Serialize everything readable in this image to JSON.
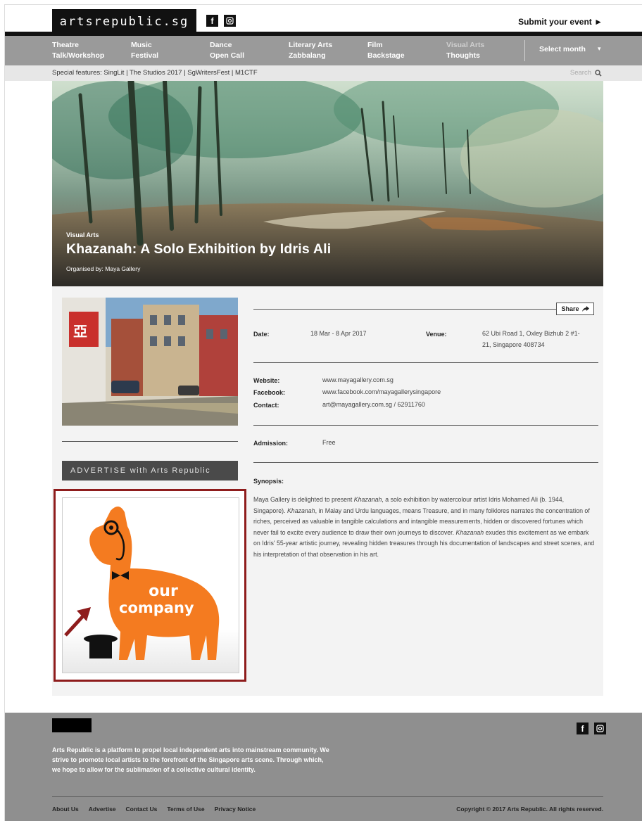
{
  "header": {
    "logo": "artsrepublic.sg",
    "social_icons": [
      "facebook-icon",
      "instagram-icon"
    ],
    "submit_label": "Submit your event ►"
  },
  "nav": {
    "items": [
      {
        "label": "Theatre"
      },
      {
        "label": "Music"
      },
      {
        "label": "Dance"
      },
      {
        "label": "Literary Arts"
      },
      {
        "label": "Film"
      },
      {
        "label": "Visual Arts",
        "active": true
      },
      {
        "label": "Talk/Workshop"
      },
      {
        "label": "Festival"
      },
      {
        "label": "Open Call"
      },
      {
        "label": "Zabbalang"
      },
      {
        "label": "Backstage"
      },
      {
        "label": "Thoughts"
      }
    ],
    "month_select": "Select month",
    "month_arrow": "▾"
  },
  "special": {
    "text": "Special features: SingLit | The Studios 2017 | SgWritersFest | M1CTF",
    "search_placeholder": "Search",
    "search_icon": "search-icon"
  },
  "hero": {
    "category": "Visual Arts",
    "title": "Khazanah: A Solo Exhibition by Idris Ali",
    "organiser": "Organised by: Maya Gallery"
  },
  "event": {
    "share_label": "Share",
    "date_label": "Date:",
    "date_value": "18 Mar - 8 Apr 2017",
    "venue_label": "Venue:",
    "venue_line1": "62 Ubi Road 1, Oxley Bizhub 2 #1-",
    "venue_line2": "21, Singapore 408734",
    "website_label": "Website:",
    "website_value": "www.mayagallery.com.sg",
    "facebook_label": "Facebook:",
    "facebook_value": "www.facebook.com/mayagallerysingapore",
    "contact_label": "Contact:",
    "contact_value": "art@mayagallery.com.sg / 62911760",
    "admission_label": "Admission:",
    "admission_value": "Free",
    "synopsis_label": "Synopsis:",
    "synopsis": {
      "p1": "Maya Gallery is delighted to present ",
      "i1": "Khazanah",
      "p2": ", a solo exhibition by watercolour artist Idris Mohamed Ali (b. 1944, Singapore). ",
      "i2": "Khazanah",
      "p3": ", in Malay and Urdu languages, means Treasure, and in many folklores narrates the concentration of riches, perceived as valuable in tangible calculations and intangible measurements, hidden or discovered fortunes which never fail to excite every audience to draw their own journeys to discover. ",
      "i3": "Khazanah",
      "p4": " exudes this excitement as we embark on Idris' 55-year artistic journey, revealing hidden treasures through his documentation of landscapes and street scenes, and his interpretation of that observation in his art."
    }
  },
  "sidebar": {
    "advertise_strong": "ADVERTISE",
    "advertise_rest": " with Arts Republic",
    "ad_line1": "our",
    "ad_line2": "company"
  },
  "footer": {
    "about": "Arts Republic is a platform to propel local independent arts into mainstream community. We strive to promote local artists to the forefront of the Singapore arts scene. Through which, we hope to allow for the sublimation of a collective cultural identity.",
    "links": [
      "About Us",
      "Advertise",
      "Contact Us",
      "Terms of Use",
      "Privacy Notice"
    ],
    "copyright": "Copyright © 2017 Arts Republic. All rights reserved."
  },
  "colors": {
    "nav_bg": "#9a9a9a",
    "footer_bg": "#8f8f8f",
    "ad_orange": "#f47b20",
    "ad_border": "#8e1c1c"
  }
}
